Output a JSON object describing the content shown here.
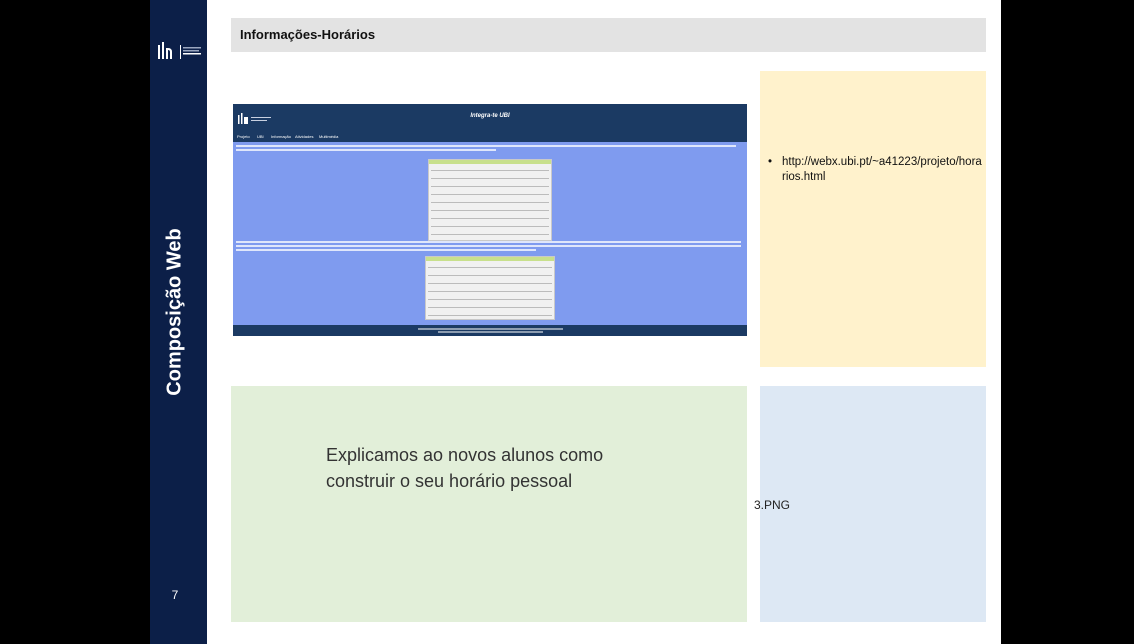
{
  "sidebar": {
    "title": "Composição Web",
    "page_number": "7"
  },
  "header": {
    "title": "Informações-Horários"
  },
  "screenshot": {
    "title": "Integra-te UBI",
    "nav": [
      "Projeto",
      "UBI",
      "Informação",
      "Atividades",
      "Multimédia"
    ]
  },
  "info_box": {
    "bullet": "•",
    "url": "http://webx.ubi.pt/~a41223/projeto/horarios.html"
  },
  "description": {
    "text": "Explicamos ao novos alunos como construir o seu horário pessoal"
  },
  "image_caption": {
    "text": "3.PNG"
  },
  "colors": {
    "sidebar": "#0c1f48",
    "header": "#e3e3e3",
    "yellow_box": "#fff2cc",
    "green_box": "#e2efd9",
    "blue_box": "#dde8f4",
    "screenshot_bg": "#7f9bef",
    "screenshot_bar": "#1b3a63"
  }
}
